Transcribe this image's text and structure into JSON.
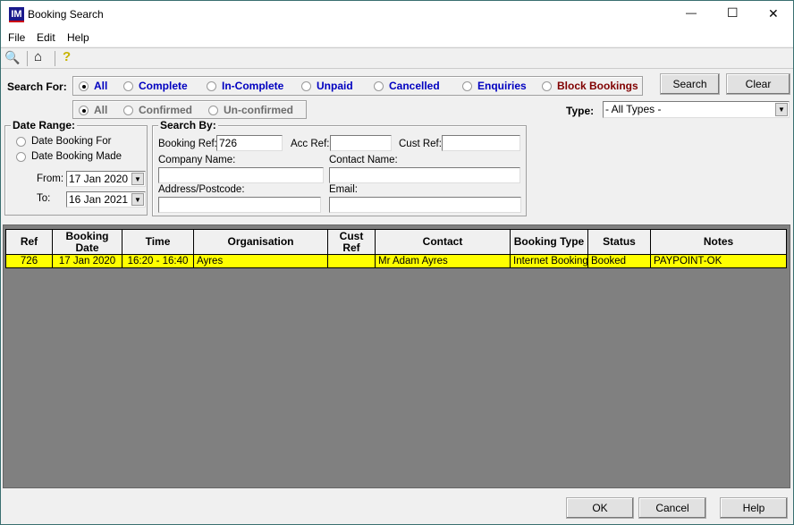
{
  "window": {
    "title": "Booking Search",
    "app_icon": "IM",
    "controls": {
      "minimize": "—",
      "maximize": "☐",
      "close": "✕"
    }
  },
  "menu": [
    "File",
    "Edit",
    "Help"
  ],
  "toolbar": [
    "search-icon",
    "home-icon",
    "help-icon"
  ],
  "search_for": {
    "label": "Search For:",
    "options": [
      "All",
      "Complete",
      "In-Complete",
      "Unpaid",
      "Cancelled",
      "Enquiries",
      "Block Bookings"
    ],
    "selected": "All",
    "block_color": "#800000",
    "option_color": "#0000c0"
  },
  "confirm_filter": {
    "options": [
      "All",
      "Confirmed",
      "Un-confirmed"
    ],
    "selected": "All"
  },
  "buttons": {
    "search": "Search",
    "clear": "Clear",
    "ok": "OK",
    "cancel": "Cancel",
    "help": "Help"
  },
  "type": {
    "label": "Type:",
    "value": "- All Types -"
  },
  "date_range": {
    "legend": "Date Range:",
    "options": [
      "Date Booking For",
      "Date Booking Made"
    ],
    "from_label": "From:",
    "from": "17 Jan 2020",
    "to_label": "To:",
    "to": "16 Jan 2021"
  },
  "search_by": {
    "legend": "Search By:",
    "booking_ref_label": "Booking Ref:",
    "booking_ref": "726",
    "acc_ref_label": "Acc Ref:",
    "acc_ref": "",
    "cust_ref_label": "Cust Ref:",
    "cust_ref": "",
    "company_label": "Company Name:",
    "company": "",
    "contact_label": "Contact Name:",
    "contact": "",
    "address_label": "Address/Postcode:",
    "address": "",
    "email_label": "Email:",
    "email": ""
  },
  "table": {
    "columns": [
      "Ref",
      "Booking Date",
      "Time",
      "Organisation",
      "Cust Ref",
      "Contact",
      "Booking Type",
      "Status",
      "Notes"
    ],
    "rows": [
      [
        "726",
        "17 Jan 2020",
        "16:20 - 16:40",
        "Ayres",
        "",
        "Mr Adam Ayres",
        "Internet Booking",
        "Booked",
        "PAYPOINT-OK"
      ]
    ]
  }
}
